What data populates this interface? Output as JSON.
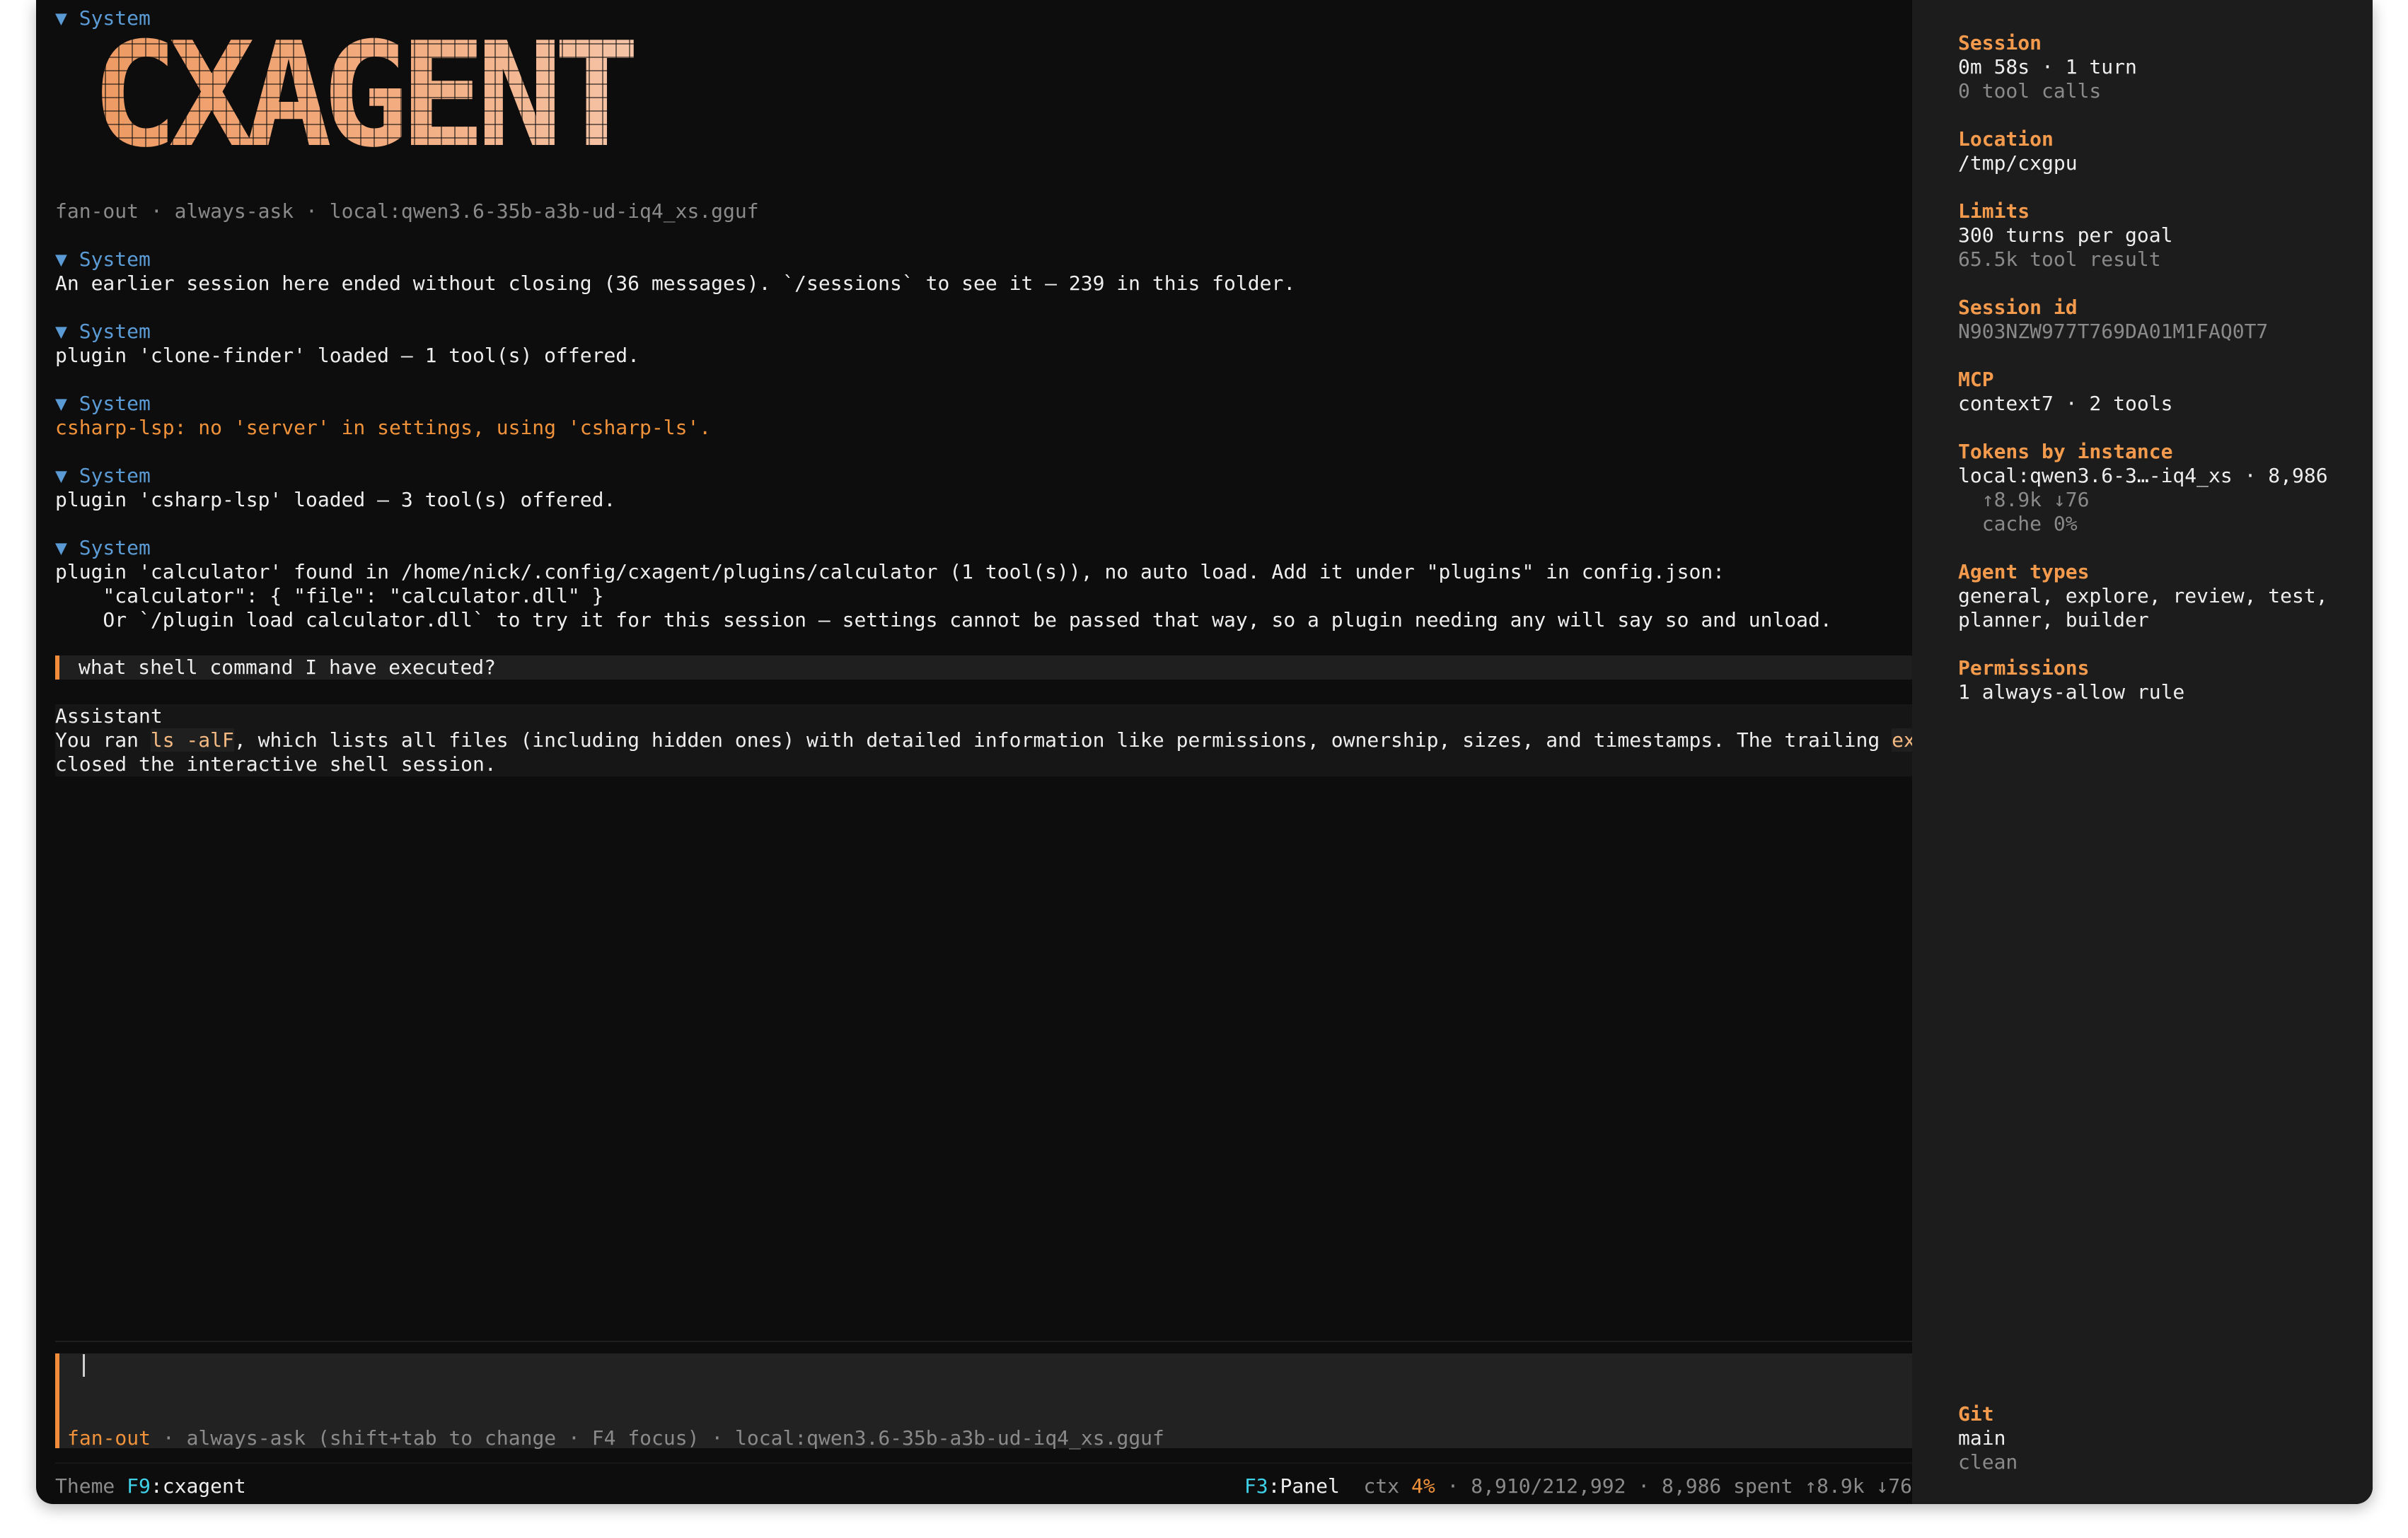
{
  "logo": {
    "text": "CXAGENT"
  },
  "header_status": "fan-out · always-ask · local:qwen3.6-35b-a3b-ud-iq4_xs.gguf",
  "system_label": "▼ System",
  "messages": [
    {
      "label": "▼ System",
      "text": "An earlier session here ended without closing (36 messages). `/sessions` to see it — 239 in this folder."
    },
    {
      "label": "▼ System",
      "text": "plugin 'clone-finder' loaded — 1 tool(s) offered."
    },
    {
      "label": "▼ System",
      "text": "csharp-lsp: no 'server' in settings, using 'csharp-ls'."
    },
    {
      "label": "▼ System",
      "text": "plugin 'csharp-lsp' loaded — 3 tool(s) offered."
    },
    {
      "label": "▼ System",
      "lines": [
        "plugin 'calculator' found in /home/nick/.config/cxagent/plugins/calculator (1 tool(s)), no auto load. Add it under \"plugins\" in config.json:",
        "    \"calculator\": { \"file\": \"calculator.dll\" }",
        "    Or `/plugin load calculator.dll` to try it for this session — settings cannot be passed that way, so a plugin needing any will say so and unload."
      ]
    }
  ],
  "user_prompt": "what shell command I have executed?",
  "assistant": {
    "label": "Assistant",
    "line1_a": "You ran ",
    "code1": "ls -alF",
    "line1_b": ", which lists all files (including hidden ones) with detailed information like permissions, ownership, sizes, and timestamps. The trailing ",
    "code2": "exit",
    "line2": "closed the interactive shell session."
  },
  "composer": {
    "mode": "fan-out",
    "rest": " · always-ask (shift+tab to change · F4 focus) · local:qwen3.6-35b-a3b-ud-iq4_xs.gguf"
  },
  "footer": {
    "theme_label": "Theme ",
    "theme_key": "F9",
    "theme_value": ":cxagent",
    "panel_key": "F3",
    "panel_label": ":Panel",
    "ctx_label": "ctx ",
    "ctx_pct": "4%",
    "ctx_rest": " · 8,910/212,992 · 8,986 spent ↑8.9k ↓76"
  },
  "panel": {
    "session": {
      "title": "Session",
      "line1": "0m 58s · 1 turn",
      "line2": "0 tool calls"
    },
    "location": {
      "title": "Location",
      "line1": "/tmp/cxgpu"
    },
    "limits": {
      "title": "Limits",
      "line1": "300 turns per goal",
      "line2": "65.5k tool result"
    },
    "session_id": {
      "title": "Session id",
      "line1": "N903NZW977T769DA01M1FAQ0T7"
    },
    "mcp": {
      "title": "MCP",
      "line1": "context7 · 2 tools"
    },
    "tokens": {
      "title": "Tokens by instance",
      "line1": "local:qwen3.6-3…-iq4_xs · 8,986",
      "line2": "  ↑8.9k ↓76",
      "line3": "  cache 0%"
    },
    "agent_types": {
      "title": "Agent types",
      "line1": "general, explore, review, test,",
      "line2": "planner, builder"
    },
    "permissions": {
      "title": "Permissions",
      "line1": "1 always-allow rule"
    },
    "git": {
      "title": "Git",
      "line1": "main",
      "line2": "clean"
    }
  },
  "colors": {
    "accent": "#f08c3a",
    "system_blue": "#5b9bd5",
    "key_cyan": "#3fd1e8",
    "panel_title": "#f39a4d"
  }
}
